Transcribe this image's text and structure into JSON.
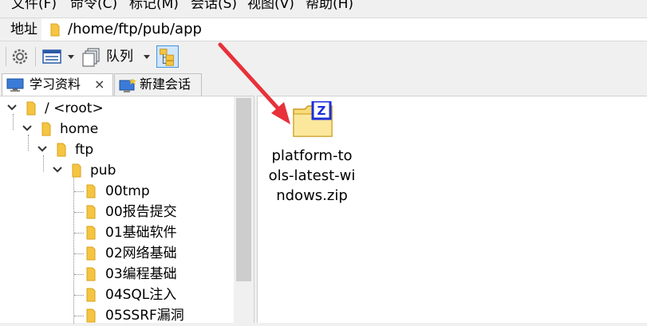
{
  "menu": {
    "items": [
      "文件(F)",
      "命令(C)",
      "标记(M)",
      "会话(S)",
      "视图(V)",
      "帮助(H)"
    ]
  },
  "address": {
    "label": "地址",
    "path": "/home/ftp/pub/app"
  },
  "toolbar": {
    "queue_label": "队列"
  },
  "tabs": [
    {
      "label": "学习资料",
      "close": "×",
      "active": true
    },
    {
      "label": "新建会话",
      "active": false
    }
  ],
  "tree": {
    "nodes": [
      {
        "label": "/ <root>",
        "depth": 0,
        "expanded": true
      },
      {
        "label": "home",
        "depth": 1,
        "expanded": true
      },
      {
        "label": "ftp",
        "depth": 2,
        "expanded": true
      },
      {
        "label": "pub",
        "depth": 3,
        "expanded": true
      },
      {
        "label": "00tmp",
        "depth": 4
      },
      {
        "label": "00报告提交",
        "depth": 4
      },
      {
        "label": "01基础软件",
        "depth": 4
      },
      {
        "label": "02网络基础",
        "depth": 4
      },
      {
        "label": "03编程基础",
        "depth": 4
      },
      {
        "label": "04SQL注入",
        "depth": 4
      },
      {
        "label": "05SSRF漏洞",
        "depth": 4
      }
    ]
  },
  "files": [
    {
      "name_lines": [
        "platform-to",
        "ols-latest-wi",
        "ndows.zip"
      ],
      "icon": "zip-folder-icon"
    }
  ],
  "colors": {
    "folder": "#f5c542",
    "arrow": "#e8313a",
    "zip_blue": "#1c2fd8"
  }
}
